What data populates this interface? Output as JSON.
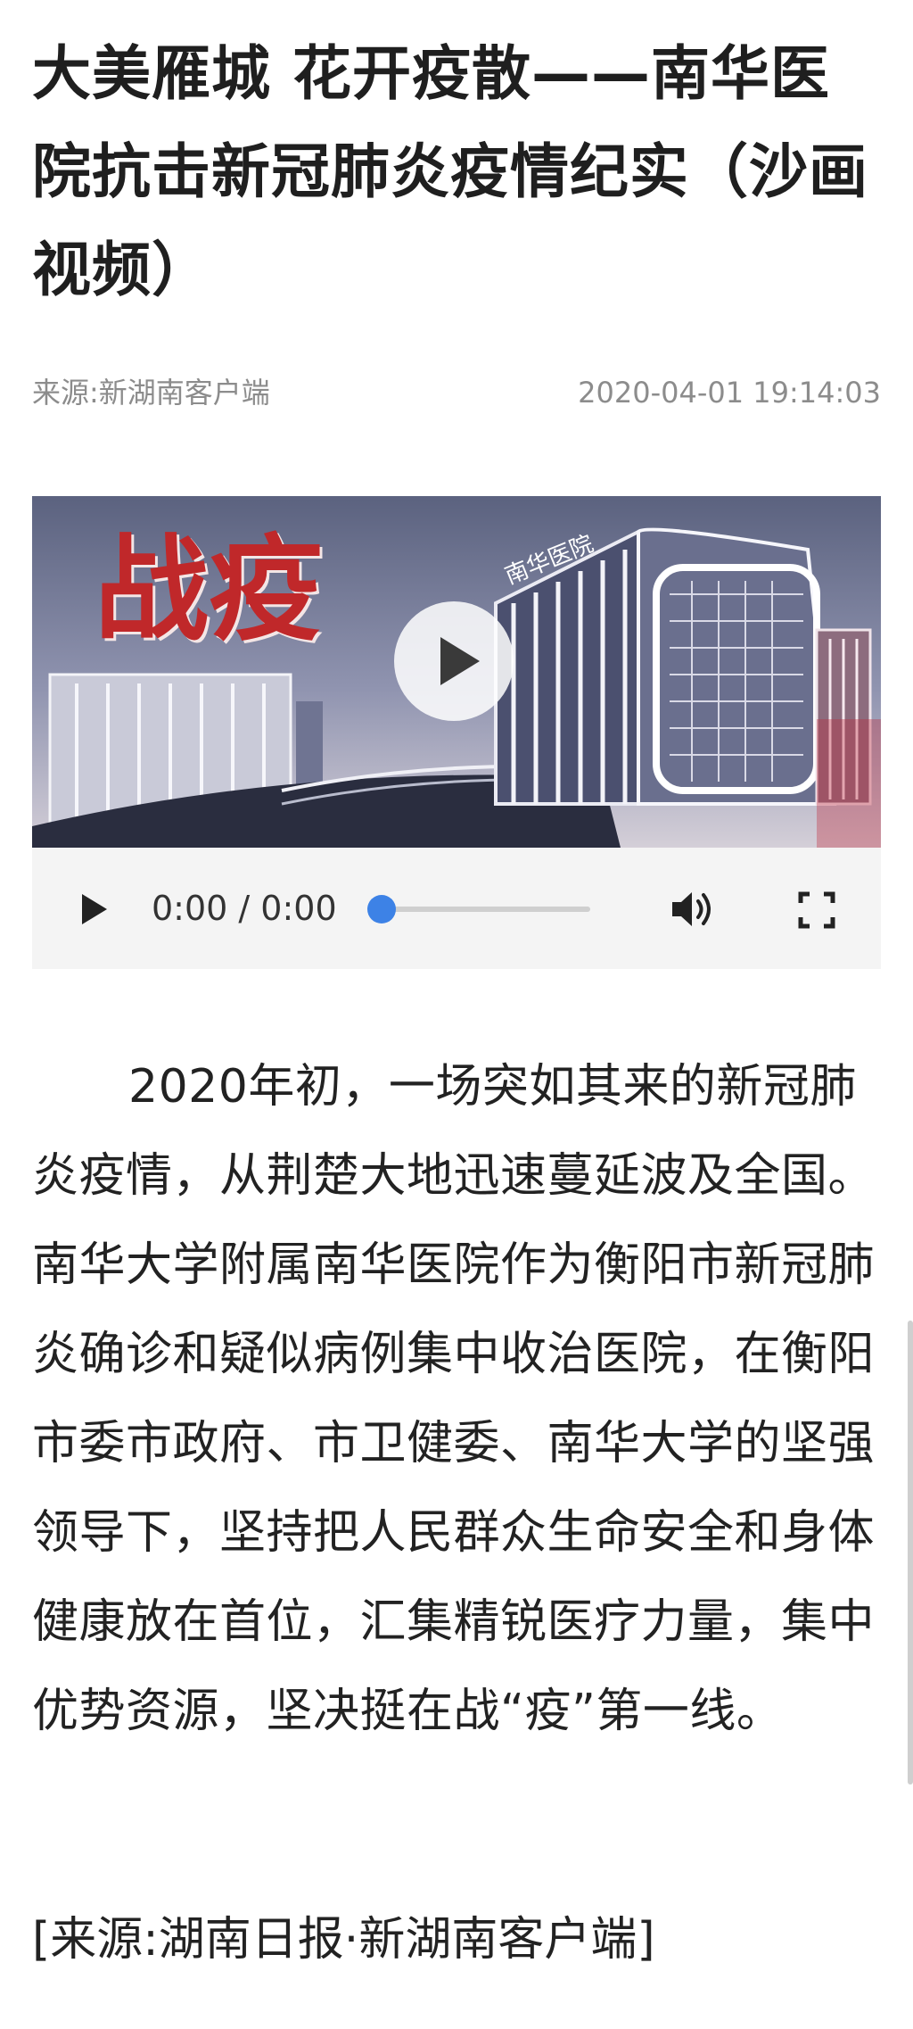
{
  "article": {
    "title": "大美雁城 花开疫散——南华医院抗击新冠肺炎疫情纪实（沙画视频）",
    "source": "来源:新湖南客户端",
    "published": "2020-04-01 19:14:03",
    "paragraph": "2020年初，一场突如其来的新冠肺炎疫情，从荆楚大地迅速蔓延波及全国。南华大学附属南华医院作为衡阳市新冠肺炎确诊和疑似病例集中收治医院，在衡阳市委市政府、市卫健委、南华大学的坚强领导下，坚持把人民群众生命安全和身体健康放在首位，汇集精锐医疗力量，集中优势资源，坚决挺在战“疫”第一线。",
    "footer_source": "[来源:湖南日报·新湖南客户端]"
  },
  "video": {
    "poster_heading": "战疫",
    "poster_sign": "南华医院",
    "time_display": "0:00 / 0:00",
    "progress": 0,
    "icons": {
      "play_overlay": "play-icon",
      "play": "play-icon",
      "volume": "volume-icon",
      "fullscreen": "fullscreen-icon"
    }
  },
  "colors": {
    "progress_thumb": "#3d82e6",
    "poster_heading": "#c0282a",
    "meta_text": "#8c8c8c"
  }
}
